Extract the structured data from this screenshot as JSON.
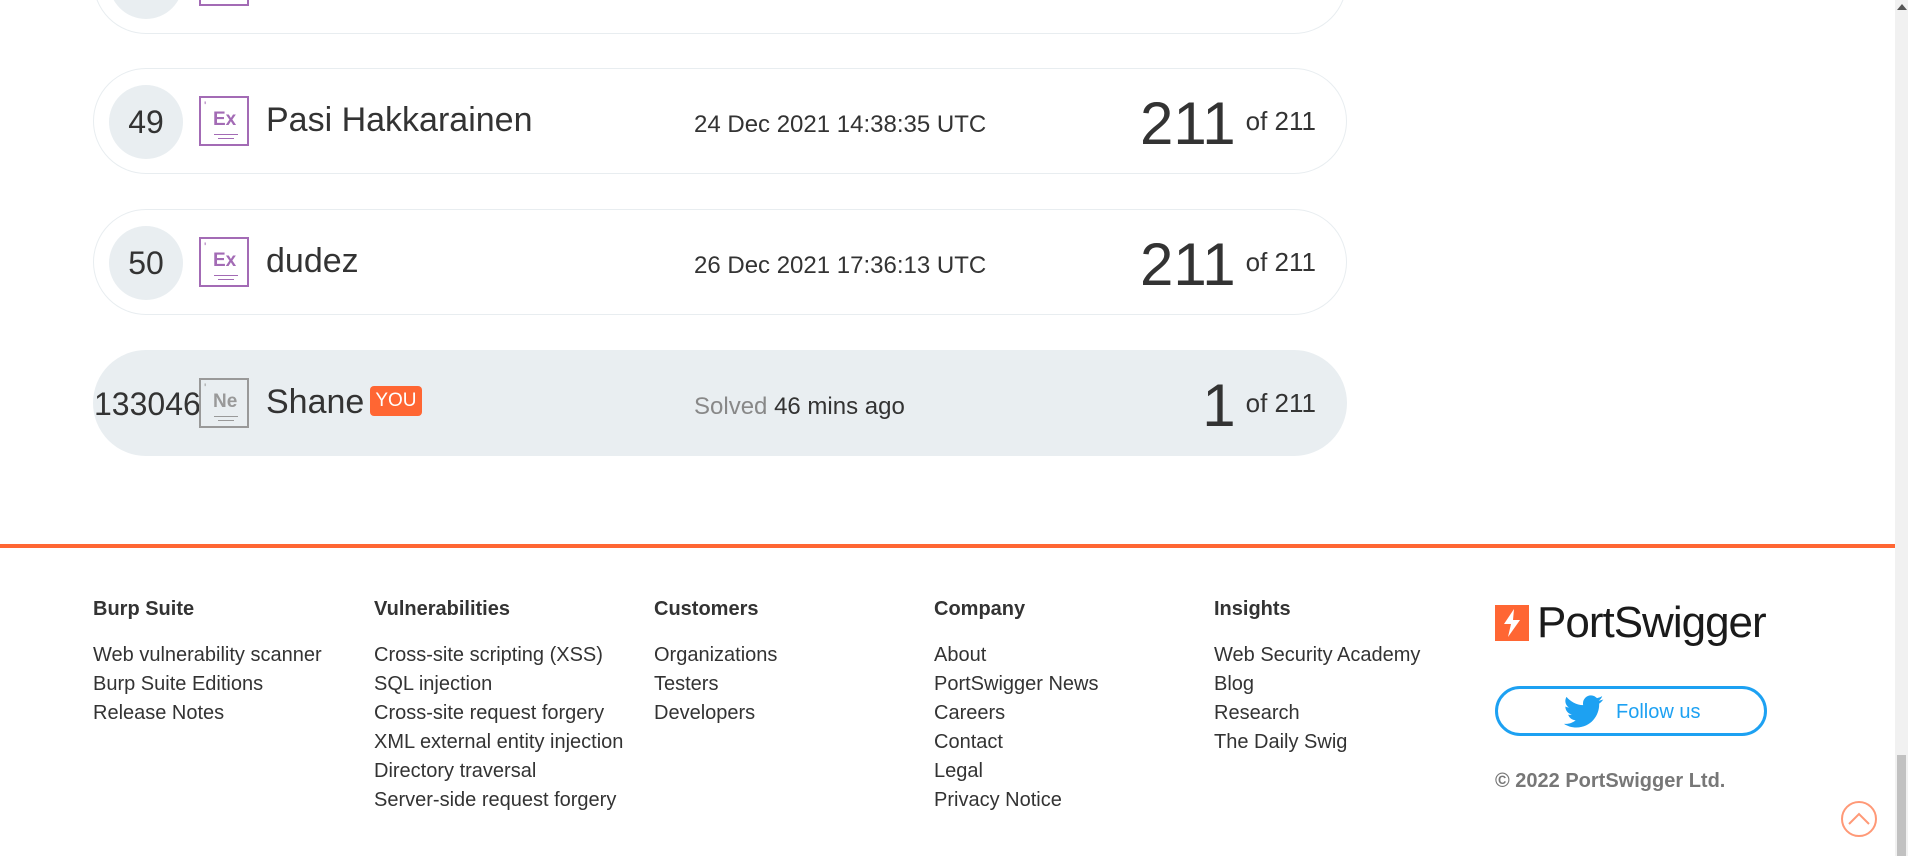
{
  "leaderboard": {
    "rows": [
      {
        "rank": "49",
        "badge": "Ex",
        "name": "Pasi Hakkarainen",
        "date": "24 Dec 2021 14:38:35 UTC",
        "score": "211",
        "of": "of 211"
      },
      {
        "rank": "50",
        "badge": "Ex",
        "name": "dudez",
        "date": "26 Dec 2021 17:36:13 UTC",
        "score": "211",
        "of": "of 211"
      }
    ],
    "current_user": {
      "rank": "133046",
      "badge": "Ne",
      "name": "Shane",
      "tag": "YOU",
      "solved_label": "Solved",
      "solved_time": "46 mins ago",
      "score": "1",
      "of": "of 211"
    }
  },
  "footer": {
    "columns": [
      {
        "heading": "Burp Suite",
        "links": [
          "Web vulnerability scanner",
          "Burp Suite Editions",
          "Release Notes"
        ]
      },
      {
        "heading": "Vulnerabilities",
        "links": [
          "Cross-site scripting (XSS)",
          "SQL injection",
          "Cross-site request forgery",
          "XML external entity injection",
          "Directory traversal",
          "Server-side request forgery"
        ]
      },
      {
        "heading": "Customers",
        "links": [
          "Organizations",
          "Testers",
          "Developers"
        ]
      },
      {
        "heading": "Company",
        "links": [
          "About",
          "PortSwigger News",
          "Careers",
          "Contact",
          "Legal",
          "Privacy Notice"
        ]
      },
      {
        "heading": "Insights",
        "links": [
          "Web Security Academy",
          "Blog",
          "Research",
          "The Daily Swig"
        ]
      }
    ],
    "brand": "PortSwigger",
    "follow_label": "Follow us",
    "copyright": "© 2022 PortSwigger Ltd."
  },
  "icons": {
    "logo": "portswigger-logo-icon",
    "twitter": "twitter-bird-icon",
    "back_to_top": "chevron-up-icon"
  },
  "colors": {
    "accent": "#ff6633",
    "expert_badge": "#a36bb5",
    "twitter": "#1da1f2"
  }
}
